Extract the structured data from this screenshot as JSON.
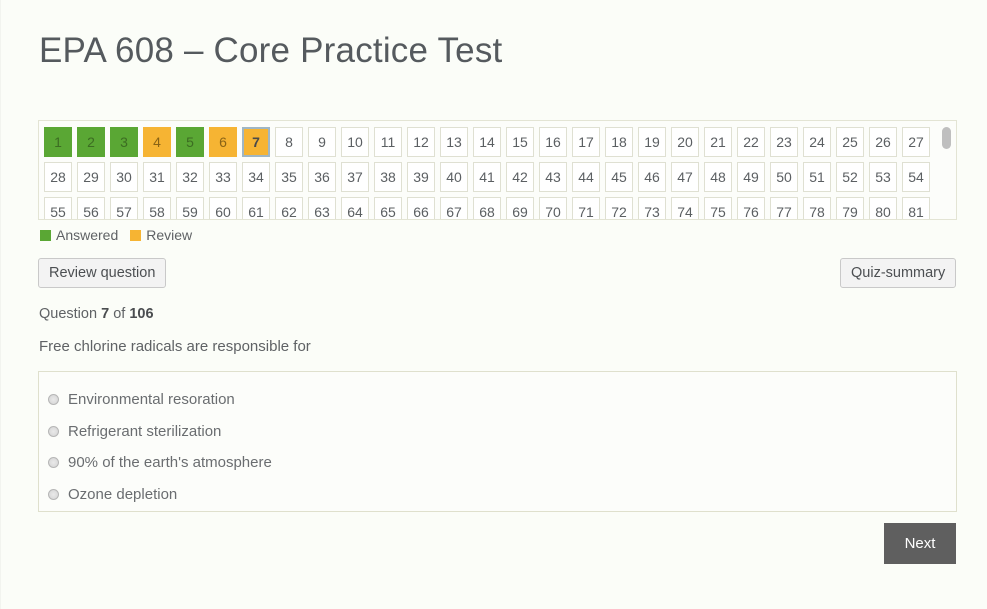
{
  "page": {
    "title": "EPA 608 – Core Practice Test",
    "background_color": "#fbfdf8"
  },
  "colors": {
    "answered": "#5aa734",
    "review": "#f6b433",
    "current_border": "#9fb6c4",
    "next_button": "#5f5f5f"
  },
  "grid": {
    "columns": 27,
    "cells": [
      {
        "number": "1",
        "state": "answered"
      },
      {
        "number": "2",
        "state": "answered"
      },
      {
        "number": "3",
        "state": "answered"
      },
      {
        "number": "4",
        "state": "review"
      },
      {
        "number": "5",
        "state": "answered"
      },
      {
        "number": "6",
        "state": "review"
      },
      {
        "number": "7",
        "state": "current"
      },
      {
        "number": "8",
        "state": "none"
      },
      {
        "number": "9",
        "state": "none"
      },
      {
        "number": "10",
        "state": "none"
      },
      {
        "number": "11",
        "state": "none"
      },
      {
        "number": "12",
        "state": "none"
      },
      {
        "number": "13",
        "state": "none"
      },
      {
        "number": "14",
        "state": "none"
      },
      {
        "number": "15",
        "state": "none"
      },
      {
        "number": "16",
        "state": "none"
      },
      {
        "number": "17",
        "state": "none"
      },
      {
        "number": "18",
        "state": "none"
      },
      {
        "number": "19",
        "state": "none"
      },
      {
        "number": "20",
        "state": "none"
      },
      {
        "number": "21",
        "state": "none"
      },
      {
        "number": "22",
        "state": "none"
      },
      {
        "number": "23",
        "state": "none"
      },
      {
        "number": "24",
        "state": "none"
      },
      {
        "number": "25",
        "state": "none"
      },
      {
        "number": "26",
        "state": "none"
      },
      {
        "number": "27",
        "state": "none"
      },
      {
        "number": "28",
        "state": "none"
      },
      {
        "number": "29",
        "state": "none"
      },
      {
        "number": "30",
        "state": "none"
      },
      {
        "number": "31",
        "state": "none"
      },
      {
        "number": "32",
        "state": "none"
      },
      {
        "number": "33",
        "state": "none"
      },
      {
        "number": "34",
        "state": "none"
      },
      {
        "number": "35",
        "state": "none"
      },
      {
        "number": "36",
        "state": "none"
      },
      {
        "number": "37",
        "state": "none"
      },
      {
        "number": "38",
        "state": "none"
      },
      {
        "number": "39",
        "state": "none"
      },
      {
        "number": "40",
        "state": "none"
      },
      {
        "number": "41",
        "state": "none"
      },
      {
        "number": "42",
        "state": "none"
      },
      {
        "number": "43",
        "state": "none"
      },
      {
        "number": "44",
        "state": "none"
      },
      {
        "number": "45",
        "state": "none"
      },
      {
        "number": "46",
        "state": "none"
      },
      {
        "number": "47",
        "state": "none"
      },
      {
        "number": "48",
        "state": "none"
      },
      {
        "number": "49",
        "state": "none"
      },
      {
        "number": "50",
        "state": "none"
      },
      {
        "number": "51",
        "state": "none"
      },
      {
        "number": "52",
        "state": "none"
      },
      {
        "number": "53",
        "state": "none"
      },
      {
        "number": "54",
        "state": "none"
      },
      {
        "number": "55",
        "state": "none"
      },
      {
        "number": "56",
        "state": "none"
      },
      {
        "number": "57",
        "state": "none"
      },
      {
        "number": "58",
        "state": "none"
      },
      {
        "number": "59",
        "state": "none"
      },
      {
        "number": "60",
        "state": "none"
      },
      {
        "number": "61",
        "state": "none"
      },
      {
        "number": "62",
        "state": "none"
      },
      {
        "number": "63",
        "state": "none"
      },
      {
        "number": "64",
        "state": "none"
      },
      {
        "number": "65",
        "state": "none"
      },
      {
        "number": "66",
        "state": "none"
      },
      {
        "number": "67",
        "state": "none"
      },
      {
        "number": "68",
        "state": "none"
      },
      {
        "number": "69",
        "state": "none"
      },
      {
        "number": "70",
        "state": "none"
      },
      {
        "number": "71",
        "state": "none"
      },
      {
        "number": "72",
        "state": "none"
      },
      {
        "number": "73",
        "state": "none"
      },
      {
        "number": "74",
        "state": "none"
      },
      {
        "number": "75",
        "state": "none"
      },
      {
        "number": "76",
        "state": "none"
      },
      {
        "number": "77",
        "state": "none"
      },
      {
        "number": "78",
        "state": "none"
      },
      {
        "number": "79",
        "state": "none"
      },
      {
        "number": "80",
        "state": "none"
      },
      {
        "number": "81",
        "state": "none"
      }
    ]
  },
  "legend": {
    "answered_label": "Answered",
    "review_label": "Review"
  },
  "toolbar": {
    "review_question_label": "Review question",
    "quiz_summary_label": "Quiz-summary"
  },
  "question": {
    "counter_prefix": "Question",
    "counter_current": "7",
    "counter_middle": "of",
    "counter_total": "106",
    "text": "Free chlorine radicals are responsible for",
    "answers": [
      "Environmental resoration",
      "Refrigerant sterilization",
      "90% of the earth's atmosphere",
      "Ozone depletion"
    ]
  },
  "footer": {
    "next_label": "Next"
  }
}
